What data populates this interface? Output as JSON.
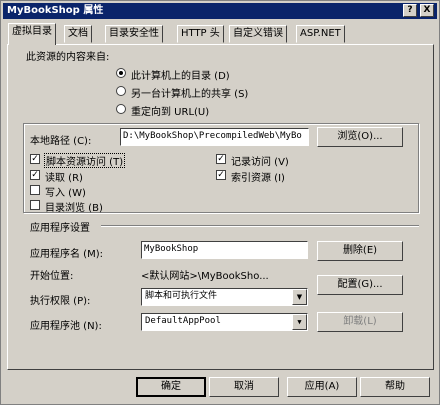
{
  "window": {
    "title": "MyBookShop 属性",
    "help_button": "?",
    "close_button": "X"
  },
  "tabs": [
    {
      "label": "虚拟目录",
      "active": true
    },
    {
      "label": "文档",
      "active": false
    },
    {
      "label": "目录安全性",
      "active": false
    },
    {
      "label": "HTTP 头",
      "active": false
    },
    {
      "label": "自定义错误",
      "active": false
    },
    {
      "label": "ASP.NET",
      "active": false
    }
  ],
  "source": {
    "heading": "此资源的内容来自:",
    "options": [
      {
        "label": "此计算机上的目录 (D)",
        "checked": true
      },
      {
        "label": "另一台计算机上的共享 (S)",
        "checked": false
      },
      {
        "label": "重定向到 URL(U)",
        "checked": false
      }
    ]
  },
  "local_path": {
    "label": "本地路径 (C):",
    "value": "D:\\MyBookShop\\PrecompiledWeb\\MyBo",
    "browse_button": "浏览(O)..."
  },
  "permissions": {
    "left": [
      {
        "label": "脚本资源访问 (T)",
        "checked": true
      },
      {
        "label": "读取 (R)",
        "checked": true
      },
      {
        "label": "写入 (W)",
        "checked": false
      },
      {
        "label": "目录浏览 (B)",
        "checked": false
      }
    ],
    "right": [
      {
        "label": "记录访问 (V)",
        "checked": true
      },
      {
        "label": "索引资源 (I)",
        "checked": true
      }
    ]
  },
  "app_settings": {
    "heading": "应用程序设置",
    "app_name_label": "应用程序名 (M):",
    "app_name_value": "MyBookShop",
    "remove_button": "删除(E)",
    "start_point_label": "开始位置:",
    "start_point_value": "<默认网站>\\MyBookSho...",
    "config_button": "配置(G)...",
    "exec_perm_label": "执行权限 (P):",
    "exec_perm_value": "脚本和可执行文件",
    "app_pool_label": "应用程序池 (N):",
    "app_pool_value": "DefaultAppPool",
    "unload_button": "卸载(L)"
  },
  "footer": {
    "ok": "确定",
    "cancel": "取消",
    "apply": "应用(A)",
    "help": "帮助"
  }
}
